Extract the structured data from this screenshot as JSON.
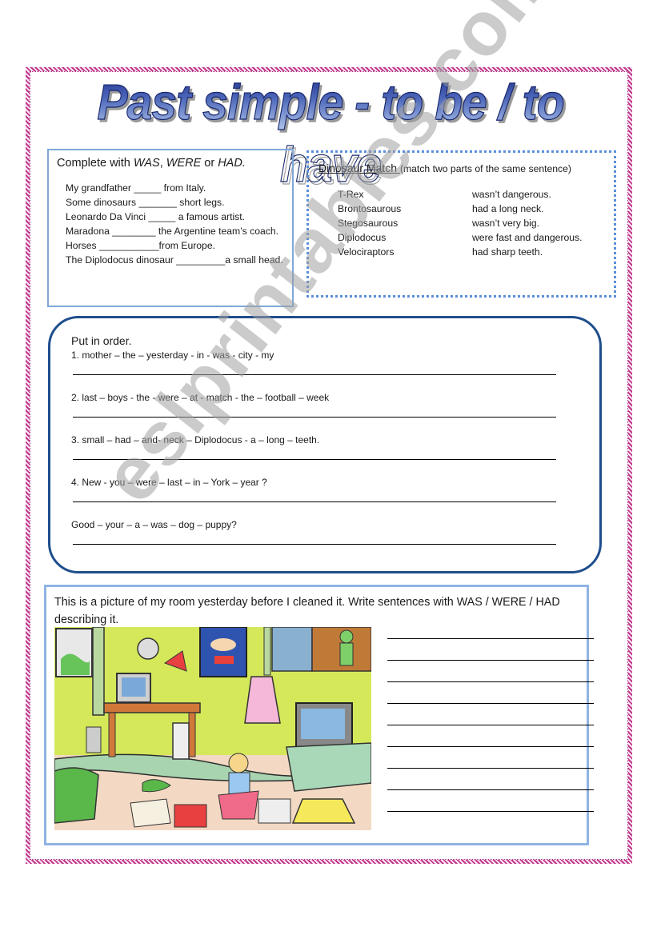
{
  "title": "Past simple - to be / to have",
  "complete_section": {
    "heading_prefix": "Complete with ",
    "word_was": "WAS",
    "sep1": ", ",
    "word_were": "WERE",
    "sep2": " or ",
    "word_had": "HAD.",
    "items": [
      "My grandfather  _____  from Italy.",
      "Some dinosaurs  _______  short legs.",
      "Leonardo Da Vinci  _____  a famous artist.",
      "Maradona  ________  the Argentine team’s coach.",
      "Horses  ___________from Europe.",
      "The Diplodocus dinosaur   _________a small head."
    ]
  },
  "match_section": {
    "heading": "Dinosaur Match ",
    "instruction": "(match two parts of the same sentence)",
    "left": [
      "T-Rex",
      "Brontosaurous",
      "Stegosaurous",
      "Diplodocus",
      "Velociraptors"
    ],
    "right": [
      "wasn’t dangerous.",
      "had a long neck.",
      "wasn’t very big.",
      "were fast and dangerous.",
      "had sharp teeth."
    ]
  },
  "order_section": {
    "heading": "Put in order.",
    "items": [
      "1. mother – the – yesterday - in - was - city - my",
      "2. last – boys - the - were – at -  match  -  the – football – week",
      "3. small – had – and- neck – Diplodocus  - a – long – teeth.",
      "4. New  - you – were – last – in – York – year ?",
      "Good – your – a – was – dog – puppy?"
    ]
  },
  "room_section": {
    "heading": "This is a picture of my room yesterday before I cleaned it. Write sentences with WAS / WERE / HAD describing it.",
    "picture_alt": "Illustration of a messy child's bedroom",
    "answer_line_count": 9
  },
  "watermark": "eslprintables.com"
}
